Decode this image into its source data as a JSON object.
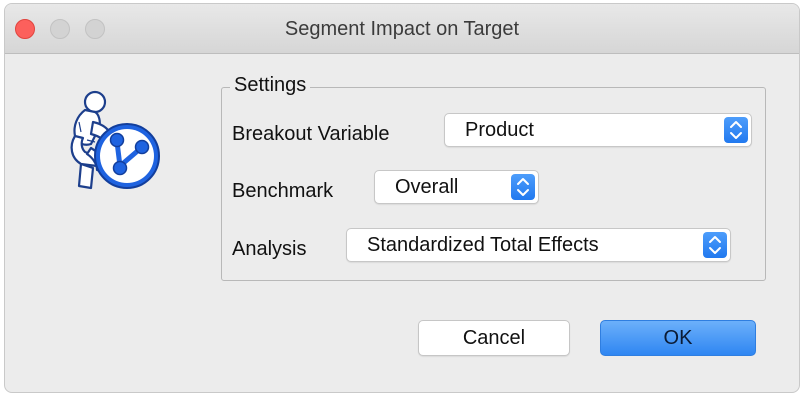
{
  "window": {
    "title": "Segment Impact on Target"
  },
  "settings": {
    "group_label": "Settings",
    "breakout_variable": {
      "label": "Breakout Variable",
      "value": "Product"
    },
    "benchmark": {
      "label": "Benchmark",
      "value": "Overall"
    },
    "analysis": {
      "label": "Analysis",
      "value": "Standardized Total Effects"
    }
  },
  "buttons": {
    "cancel_label": "Cancel",
    "ok_label": "OK"
  },
  "colors": {
    "window_bg": "#ececec",
    "accent": "#2f86f2",
    "close_light": "#fc605c",
    "icon_blue": "#1f63e0"
  },
  "icons": {
    "app": "thinker-with-path-diagram-icon",
    "stepper": "up-down-chevron-icon"
  }
}
